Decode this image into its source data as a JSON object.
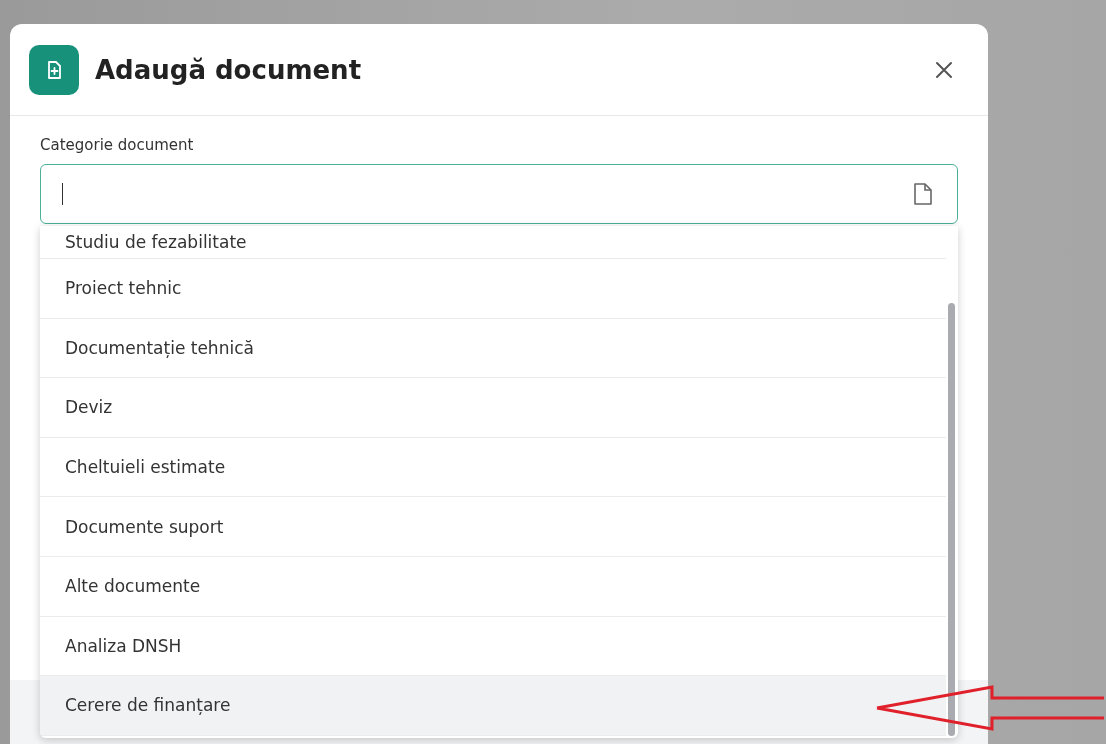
{
  "dialog": {
    "title": "Adaugă document"
  },
  "field": {
    "label": "Categorie document"
  },
  "options": [
    {
      "label": "Studiu de fezabilitate",
      "selected": false
    },
    {
      "label": "Proiect tehnic",
      "selected": false
    },
    {
      "label": "Documentație tehnică",
      "selected": false
    },
    {
      "label": "Deviz",
      "selected": false
    },
    {
      "label": "Cheltuieli estimate",
      "selected": false
    },
    {
      "label": "Documente suport",
      "selected": false
    },
    {
      "label": "Alte documente",
      "selected": false
    },
    {
      "label": "Analiza DNSH",
      "selected": false
    },
    {
      "label": "Cerere de finanțare",
      "selected": true
    }
  ]
}
